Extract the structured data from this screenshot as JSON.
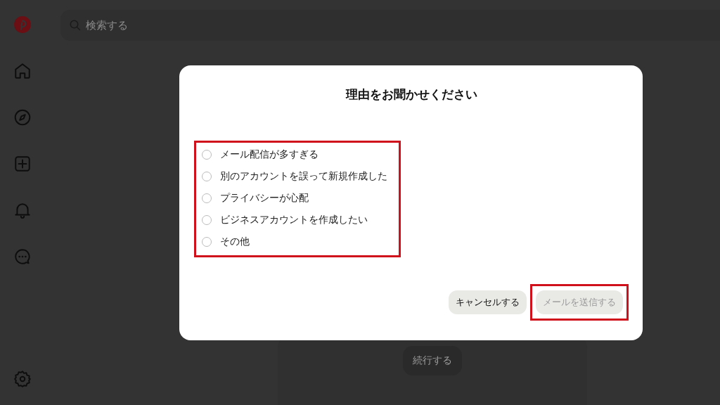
{
  "search": {
    "placeholder": "検索する"
  },
  "background": {
    "continue_button": "続行する"
  },
  "dialog": {
    "title": "理由をお聞かせください",
    "options": [
      {
        "label": "メール配信が多すぎる",
        "selected": false
      },
      {
        "label": "別のアカウントを誤って新規作成した",
        "selected": false
      },
      {
        "label": "プライバシーが心配",
        "selected": false
      },
      {
        "label": "ビジネスアカウントを作成したい",
        "selected": false
      },
      {
        "label": "その他",
        "selected": false
      }
    ],
    "buttons": [
      {
        "label": "キャンセルする",
        "disabled": false
      },
      {
        "label": "メールを送信する",
        "disabled": true
      }
    ]
  }
}
